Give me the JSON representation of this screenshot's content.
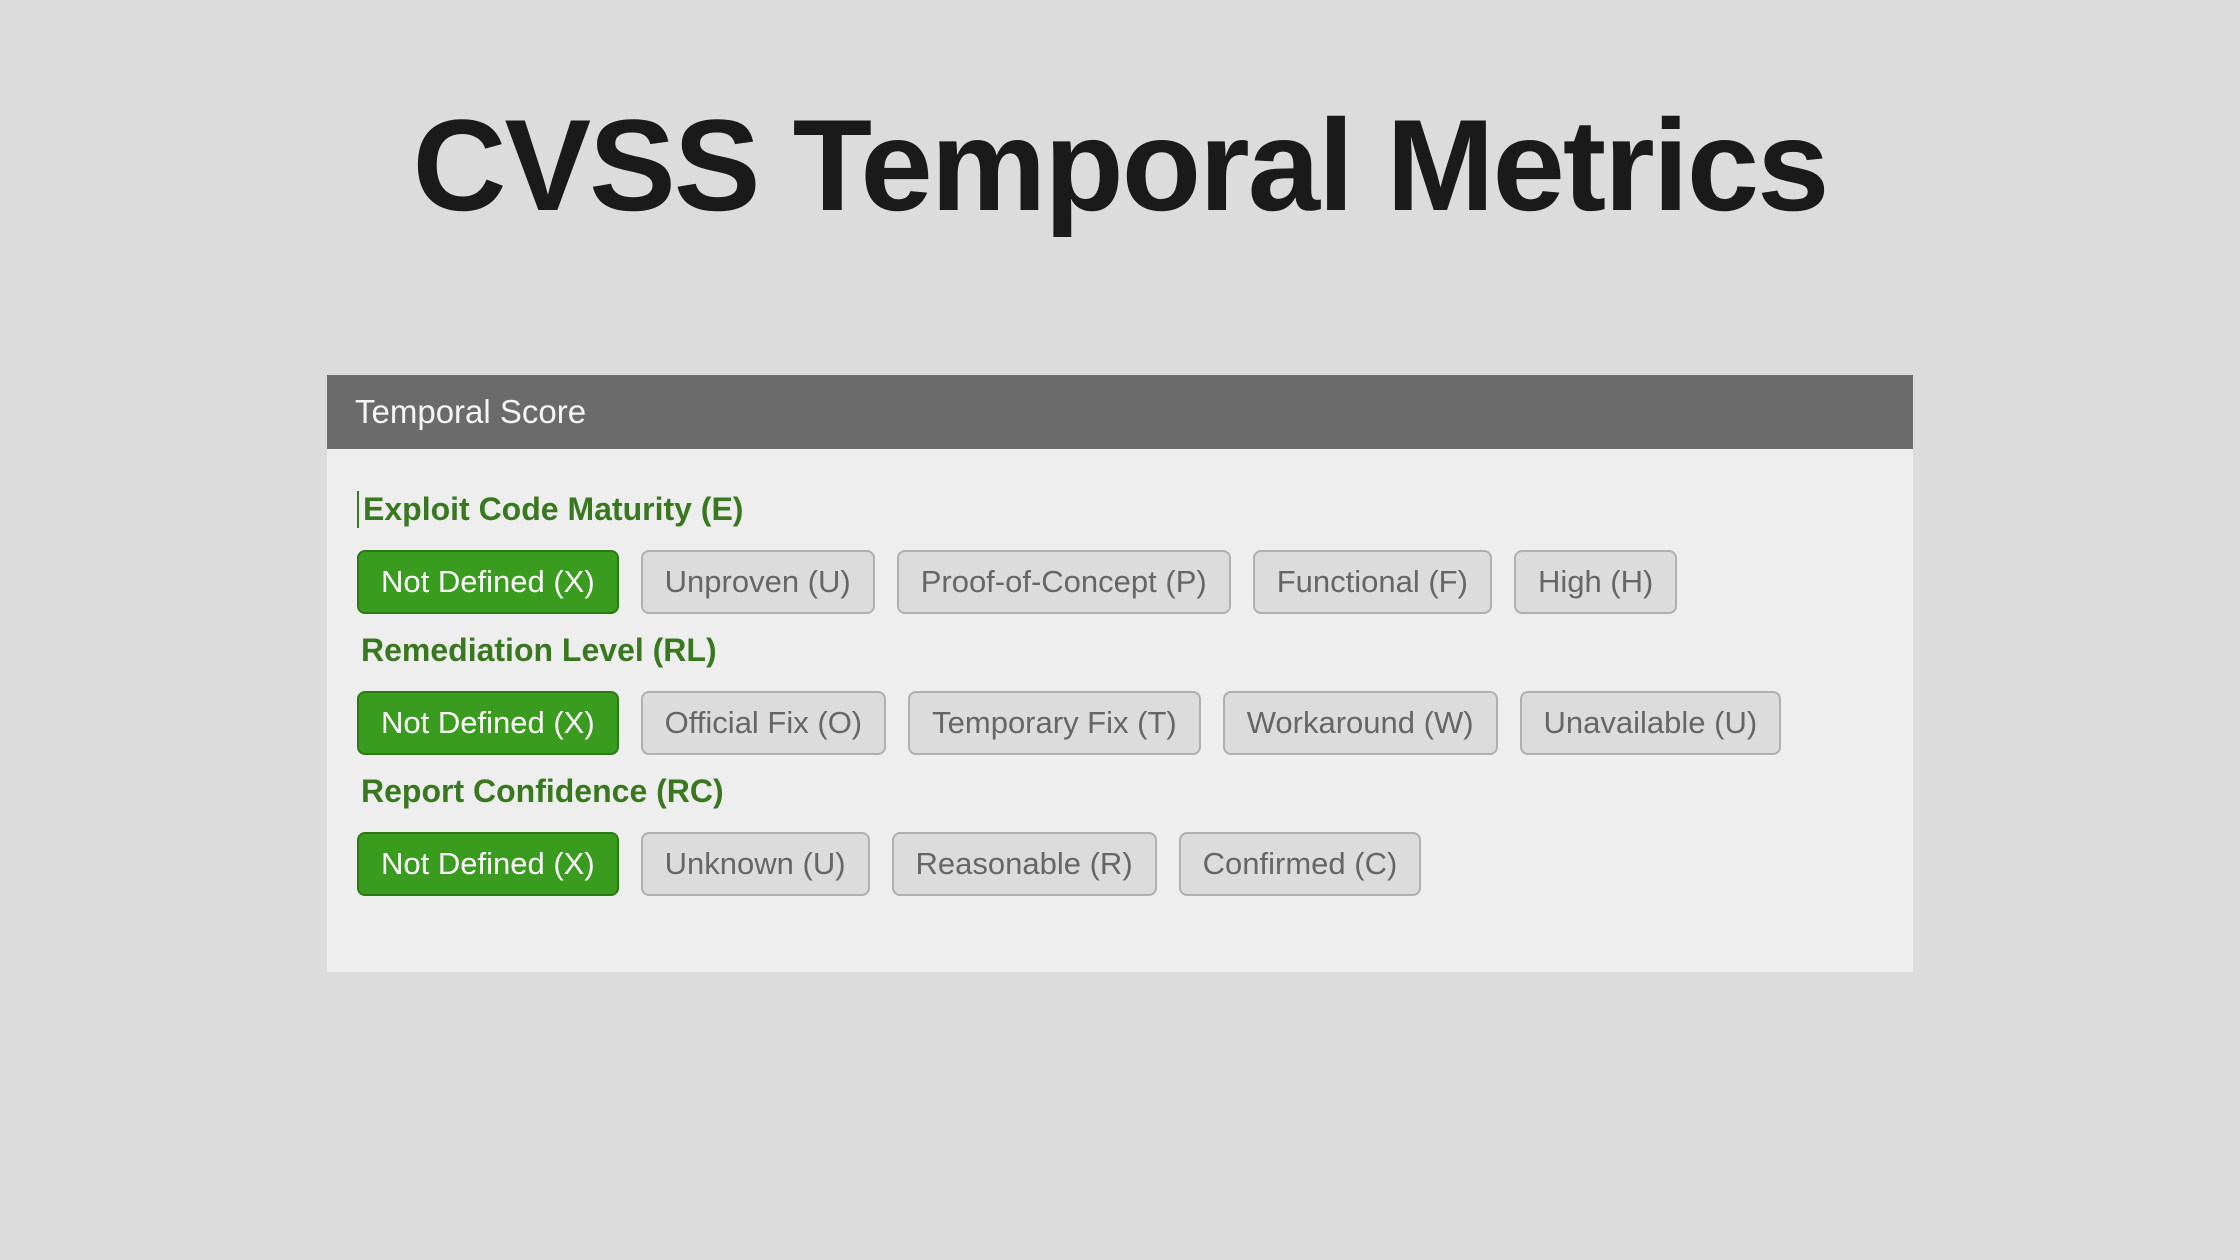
{
  "title": "CVSS Temporal Metrics",
  "panel": {
    "header": "Temporal Score",
    "metrics": [
      {
        "label": "Exploit Code Maturity (E)",
        "first": true,
        "options": [
          {
            "text": "Not Defined (X)",
            "selected": true
          },
          {
            "text": "Unproven (U)",
            "selected": false
          },
          {
            "text": "Proof-of-Concept (P)",
            "selected": false
          },
          {
            "text": "Functional (F)",
            "selected": false
          },
          {
            "text": "High (H)",
            "selected": false
          }
        ]
      },
      {
        "label": "Remediation Level (RL)",
        "first": false,
        "options": [
          {
            "text": "Not Defined (X)",
            "selected": true
          },
          {
            "text": "Official Fix (O)",
            "selected": false
          },
          {
            "text": "Temporary Fix (T)",
            "selected": false
          },
          {
            "text": "Workaround (W)",
            "selected": false
          },
          {
            "text": "Unavailable (U)",
            "selected": false
          }
        ]
      },
      {
        "label": "Report Confidence (RC)",
        "first": false,
        "options": [
          {
            "text": "Not Defined (X)",
            "selected": true
          },
          {
            "text": "Unknown (U)",
            "selected": false
          },
          {
            "text": "Reasonable (R)",
            "selected": false
          },
          {
            "text": "Confirmed (C)",
            "selected": false
          }
        ]
      }
    ]
  }
}
